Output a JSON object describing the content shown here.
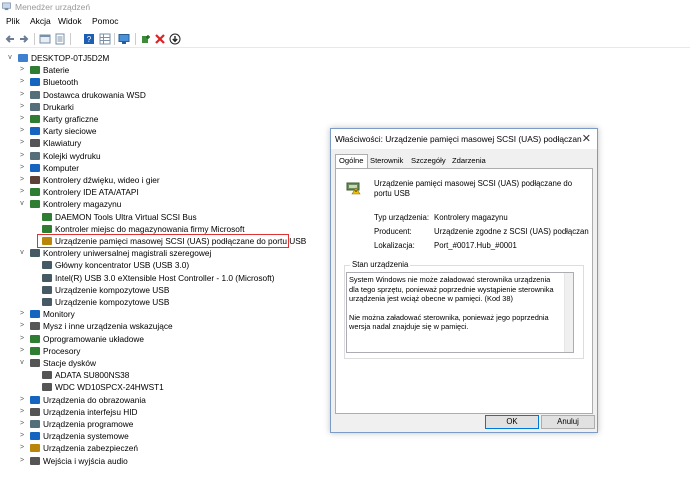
{
  "window": {
    "title": "Menedżer urządzeń"
  },
  "menu": [
    "Plik",
    "Akcja",
    "Widok",
    "Pomoc"
  ],
  "toolbar": {
    "icons": [
      "back-arrow-icon",
      "forward-arrow-icon",
      "show-tree-icon",
      "properties-icon",
      "help-icon",
      "grid-icon",
      "monitor-icon",
      "update-driver-icon",
      "uninstall-icon",
      "download-icon"
    ]
  },
  "tree": {
    "root": "DESKTOP-0TJ5D2M",
    "items": [
      {
        "label": "Baterie",
        "expander": ">",
        "level": 1,
        "color": "#2e7d32"
      },
      {
        "label": "Bluetooth",
        "expander": ">",
        "level": 1,
        "color": "#1565c0"
      },
      {
        "label": "Dostawca drukowania WSD",
        "expander": ">",
        "level": 1,
        "color": "#546e7a"
      },
      {
        "label": "Drukarki",
        "expander": ">",
        "level": 1,
        "color": "#546e7a"
      },
      {
        "label": "Karty graficzne",
        "expander": ">",
        "level": 1,
        "color": "#2e7d32"
      },
      {
        "label": "Karty sieciowe",
        "expander": ">",
        "level": 1,
        "color": "#1565c0"
      },
      {
        "label": "Klawiatury",
        "expander": ">",
        "level": 1,
        "color": "#555"
      },
      {
        "label": "Kolejki wydruku",
        "expander": ">",
        "level": 1,
        "color": "#546e7a"
      },
      {
        "label": "Komputer",
        "expander": ">",
        "level": 1,
        "color": "#1565c0"
      },
      {
        "label": "Kontrolery dźwięku, wideo i gier",
        "expander": ">",
        "level": 1,
        "color": "#5d4037"
      },
      {
        "label": "Kontrolery IDE ATA/ATAPI",
        "expander": ">",
        "level": 1,
        "color": "#2e7d32"
      },
      {
        "label": "Kontrolery magazynu",
        "expander": "v",
        "level": 1,
        "color": "#2e7d32"
      },
      {
        "label": "DAEMON Tools Ultra Virtual SCSI Bus",
        "expander": "",
        "level": 2,
        "color": "#2e7d32"
      },
      {
        "label": "Kontroler miejsc do magazynowania firmy Microsoft",
        "expander": "",
        "level": 2,
        "color": "#2e7d32"
      },
      {
        "label": "Urządzenie pamięci masowej SCSI (UAS) podłączane do portu USB",
        "expander": "",
        "level": 2,
        "color": "#b8860b"
      },
      {
        "label": "Kontrolery uniwersalnej magistrali szeregowej",
        "expander": "v",
        "level": 1,
        "color": "#455a64"
      },
      {
        "label": "Główny koncentrator USB (USB 3.0)",
        "expander": "",
        "level": 2,
        "color": "#455a64"
      },
      {
        "label": "Intel(R) USB 3.0 eXtensible Host Controller - 1.0 (Microsoft)",
        "expander": "",
        "level": 2,
        "color": "#455a64"
      },
      {
        "label": "Urządzenie kompozytowe USB",
        "expander": "",
        "level": 2,
        "color": "#455a64"
      },
      {
        "label": "Urządzenie kompozytowe USB",
        "expander": "",
        "level": 2,
        "color": "#455a64"
      },
      {
        "label": "Monitory",
        "expander": ">",
        "level": 1,
        "color": "#1565c0"
      },
      {
        "label": "Mysz i inne urządzenia wskazujące",
        "expander": ">",
        "level": 1,
        "color": "#555"
      },
      {
        "label": "Oprogramowanie układowe",
        "expander": ">",
        "level": 1,
        "color": "#2e7d32"
      },
      {
        "label": "Procesory",
        "expander": ">",
        "level": 1,
        "color": "#2e7d32"
      },
      {
        "label": "Stacje dysków",
        "expander": "v",
        "level": 1,
        "color": "#555"
      },
      {
        "label": "ADATA SU800NS38",
        "expander": "",
        "level": 2,
        "color": "#555"
      },
      {
        "label": "WDC WD10SPCX-24HWST1",
        "expander": "",
        "level": 2,
        "color": "#555"
      },
      {
        "label": "Urządzenia do obrazowania",
        "expander": ">",
        "level": 1,
        "color": "#1565c0"
      },
      {
        "label": "Urządzenia interfejsu HID",
        "expander": ">",
        "level": 1,
        "color": "#555"
      },
      {
        "label": "Urządzenia programowe",
        "expander": ">",
        "level": 1,
        "color": "#546e7a"
      },
      {
        "label": "Urządzenia systemowe",
        "expander": ">",
        "level": 1,
        "color": "#1565c0"
      },
      {
        "label": "Urządzenia zabezpieczeń",
        "expander": ">",
        "level": 1,
        "color": "#b8860b"
      },
      {
        "label": "Wejścia i wyjścia audio",
        "expander": ">",
        "level": 1,
        "color": "#555"
      }
    ]
  },
  "dialog": {
    "title": "Właściwości: Urządzenie pamięci masowej SCSI (UAS) podłączan",
    "close": "✕",
    "tabs": [
      "Ogólne",
      "Sterownik",
      "Szczegóły",
      "Zdarzenia"
    ],
    "device_name": "Urządzenie pamięci masowej SCSI (UAS) podłączane do portu USB",
    "props": [
      {
        "label": "Typ urządzenia:",
        "value": "Kontrolery magazynu"
      },
      {
        "label": "Producent:",
        "value": "Urządzenie zgodne z SCSI (UAS) podłączan"
      },
      {
        "label": "Lokalizacja:",
        "value": "Port_#0017.Hub_#0001"
      }
    ],
    "status_group": "Stan urządzenia",
    "status_text_1": "System Windows nie może załadować sterownika urządzenia dla tego sprzętu, ponieważ poprzednie wystąpienie sterownika urządzenia jest wciąż obecne w pamięci. (Kod 38)",
    "status_text_2": "Nie można załadować sterownika, ponieważ jego poprzednia wersja nadal znajduje się w pamięci.",
    "ok": "OK",
    "cancel": "Anuluj"
  }
}
